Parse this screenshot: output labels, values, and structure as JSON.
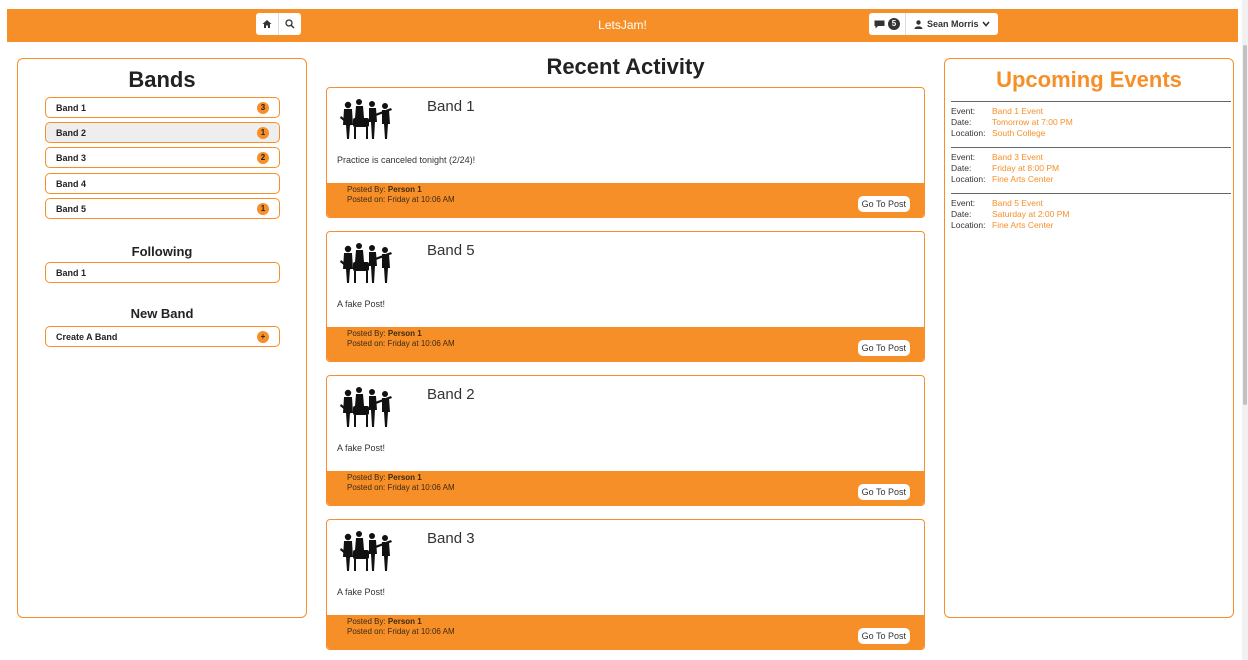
{
  "nav": {
    "brand": "LetsJam!",
    "home_icon": "home-icon",
    "search_icon": "search-icon",
    "messages_icon": "comment-icon",
    "messages_count": "5",
    "user_icon": "user-icon",
    "user_name": "Sean Morris",
    "accent": "#f78f28"
  },
  "bands": {
    "title": "Bands",
    "items": [
      {
        "label": "Band 1",
        "badge": "3"
      },
      {
        "label": "Band 2",
        "badge": "1"
      },
      {
        "label": "Band 3",
        "badge": "2"
      },
      {
        "label": "Band 4",
        "badge": ""
      },
      {
        "label": "Band 5",
        "badge": "1"
      }
    ],
    "following_title": "Following",
    "following": [
      {
        "label": "Band 1"
      }
    ],
    "new_band_title": "New Band",
    "create_label": "Create A Band",
    "create_badge": "+"
  },
  "activity": {
    "title": "Recent Activity",
    "posted_by_label": "Posted By:",
    "posted_on_label": "Posted on:",
    "goto_label": "Go To Post",
    "posts": [
      {
        "band": "Band 1",
        "text": "Practice is canceled tonight (2/24)!",
        "author": "Person 1",
        "date": "Friday at 10:06 AM"
      },
      {
        "band": "Band 5",
        "text": "A fake Post!",
        "author": "Person 1",
        "date": "Friday at 10:06 AM"
      },
      {
        "band": "Band 2",
        "text": "A fake Post!",
        "author": "Person 1",
        "date": "Friday at 10:06 AM"
      },
      {
        "band": "Band 3",
        "text": "A fake Post!",
        "author": "Person 1",
        "date": "Friday at 10:06 AM"
      }
    ]
  },
  "events": {
    "title": "Upcoming Events",
    "event_label": "Event:",
    "date_label": "Date:",
    "location_label": "Location:",
    "items": [
      {
        "event": "Band 1 Event",
        "date": "Tomorrow at 7:00 PM",
        "location": "South College"
      },
      {
        "event": "Band 3 Event",
        "date": "Friday at 8:00 PM",
        "location": "Fine Arts Center"
      },
      {
        "event": "Band 5 Event",
        "date": "Saturday at 2:00 PM",
        "location": "Fine Arts Center"
      }
    ]
  }
}
